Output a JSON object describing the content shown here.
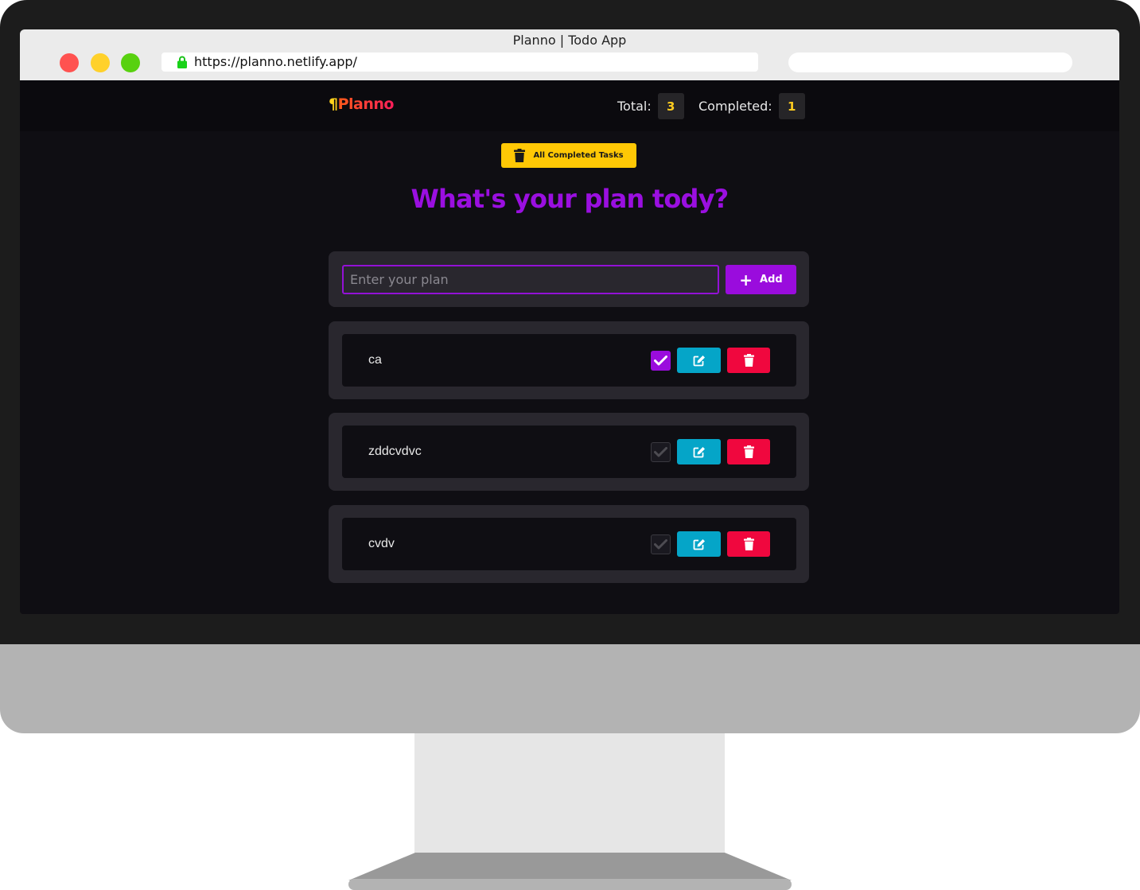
{
  "browser": {
    "window_title": "Planno | Todo App",
    "url": "https://planno.netlify.app/"
  },
  "header": {
    "logo_mark": "¶",
    "logo_text": "Planno",
    "total_label": "Total:",
    "total_value": "3",
    "completed_label": "Completed:",
    "completed_value": "1"
  },
  "actions": {
    "clear_completed_label": "All Completed Tasks"
  },
  "headline": "What's your plan tody?",
  "form": {
    "input_value": "",
    "input_placeholder": "Enter your plan",
    "add_label": "Add"
  },
  "todos": [
    {
      "text": "ca",
      "completed": true
    },
    {
      "text": "zddcvdvc",
      "completed": false
    },
    {
      "text": "cvdv",
      "completed": false
    }
  ],
  "colors": {
    "accent_purple": "#9a0cdd",
    "accent_yellow": "#ffc805",
    "edit_cyan": "#05a5c8",
    "delete_red": "#f0073e",
    "background": "#0f0e13",
    "card": "#29272e"
  },
  "icons": {
    "clear": "trash-icon",
    "add": "plus-icon",
    "check": "check-icon",
    "edit": "edit-icon",
    "delete": "trash-icon",
    "lock": "lock-icon"
  }
}
